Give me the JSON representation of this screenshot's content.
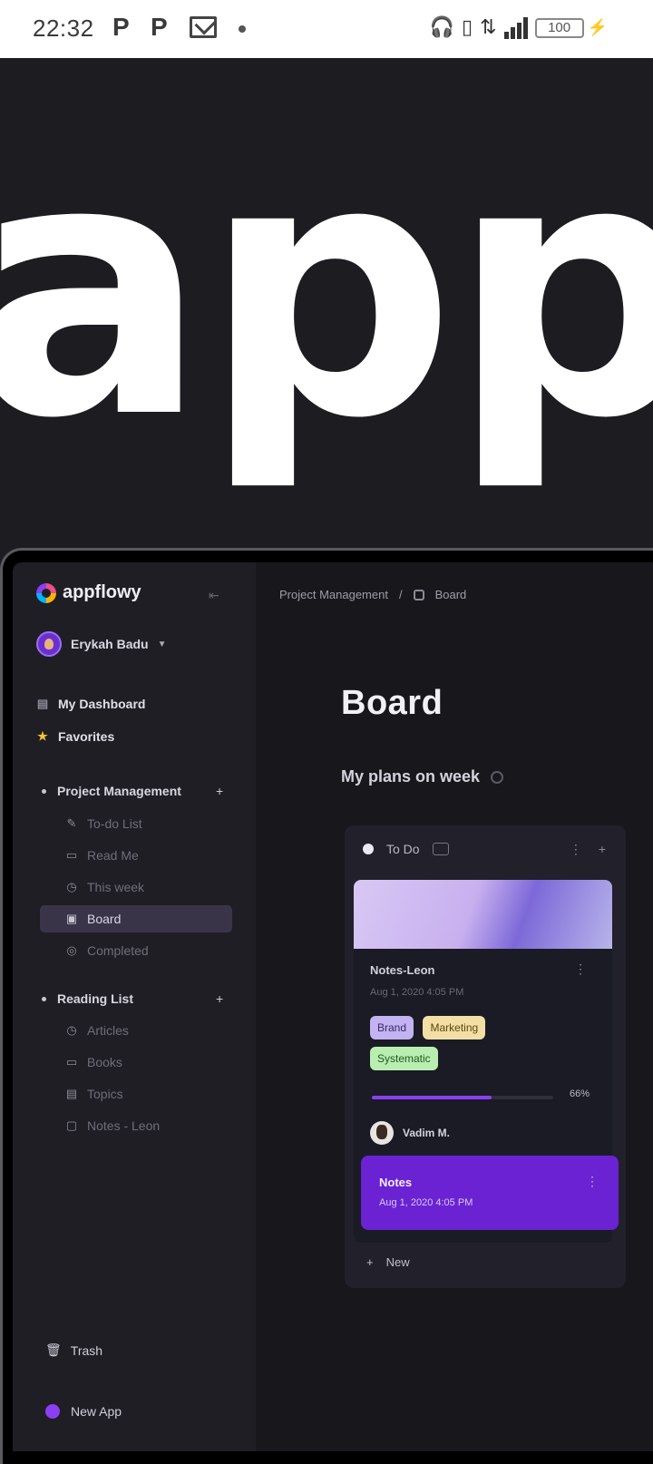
{
  "status_bar": {
    "time": "22:32",
    "notif_icons": [
      "P",
      "P"
    ],
    "battery": "100"
  },
  "hero": {
    "text": "appf"
  },
  "sidebar": {
    "app_name": "appflowy",
    "user": "Erykah Badu",
    "top_items": [
      {
        "label": "My Dashboard",
        "icon": "dashboard-icon"
      },
      {
        "label": "Favorites",
        "icon": "star-icon"
      }
    ],
    "sections": [
      {
        "label": "Project Management",
        "items": [
          {
            "label": "To-do List",
            "icon": "pencil-icon"
          },
          {
            "label": "Read Me",
            "icon": "doc-icon"
          },
          {
            "label": "This week",
            "icon": "calendar-icon"
          },
          {
            "label": "Board",
            "icon": "board-icon"
          },
          {
            "label": "Completed",
            "icon": "check-circle-icon"
          }
        ]
      },
      {
        "label": "Reading List",
        "items": [
          {
            "label": "Articles",
            "icon": "article-icon"
          },
          {
            "label": "Books",
            "icon": "book-icon"
          },
          {
            "label": "Topics",
            "icon": "topic-icon"
          },
          {
            "label": "Notes - Leon",
            "icon": "note-icon"
          }
        ]
      }
    ],
    "trash": "Trash",
    "new_app": "New App"
  },
  "main": {
    "breadcrumb": [
      "Project Management",
      "Board"
    ],
    "title": "Board",
    "subtitle": "My plans on week",
    "column": {
      "name": "To Do",
      "count": "",
      "card": {
        "title": "Notes-Leon",
        "date": "Aug 1, 2020 4:05 PM",
        "tags": [
          {
            "label": "Brand",
            "bg": "#c3b3f2",
            "fg": "#3a2a66"
          },
          {
            "label": "Marketing",
            "bg": "#f3dfa5",
            "fg": "#5a4810"
          },
          {
            "label": "Systematic",
            "bg": "#b8efb0",
            "fg": "#1f5a1a"
          }
        ],
        "progress": 0.66,
        "progress_label": "66%",
        "assignee": "Vadim M."
      },
      "card2": {
        "title": "Notes",
        "date": "Aug 1, 2020 4:05 PM"
      },
      "new_label": "New"
    }
  },
  "colors": {
    "accent": "#8b3ff2",
    "sidebar_bg": "#1f1e25",
    "main_bg": "#18171c"
  }
}
